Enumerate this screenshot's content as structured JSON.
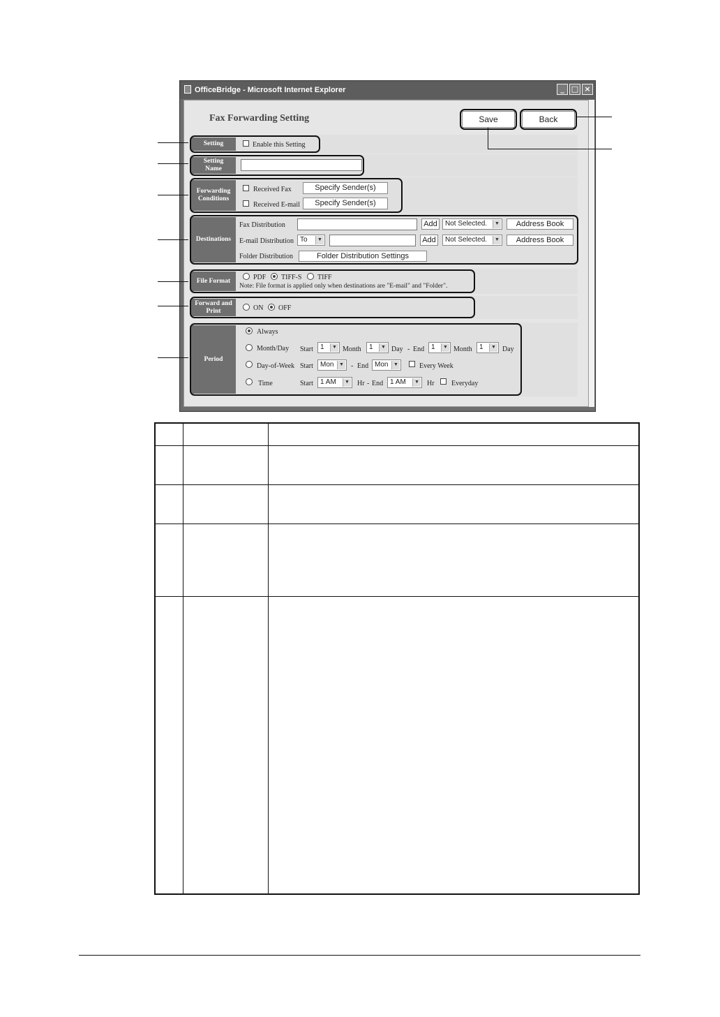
{
  "window": {
    "title": "OfficeBridge - Microsoft Internet Explorer",
    "minimize": "_",
    "maximize": "□",
    "close": "×"
  },
  "page": {
    "title": "Fax Forwarding Setting",
    "save_label": "Save",
    "back_label": "Back"
  },
  "setting": {
    "label": "Setting",
    "enable_label": "Enable this Setting"
  },
  "setting_name": {
    "label_line1": "Setting",
    "label_line2": "Name",
    "value": ""
  },
  "forwarding_conditions": {
    "label_line1": "Forwarding",
    "label_line2": "Conditions",
    "received_fax": "Received Fax",
    "received_email": "Received E-mail",
    "specify_sender": "Specify Sender(s)"
  },
  "destinations": {
    "label": "Destinations",
    "fax_distribution": "Fax Distribution",
    "email_distribution": "E-mail Distribution",
    "folder_distribution": "Folder Distribution",
    "to_option": "To",
    "add": "Add",
    "not_selected": "Not Selected.",
    "address_book": "Address Book",
    "folder_settings": "Folder Distribution Settings"
  },
  "file_format": {
    "label": "File Format",
    "pdf": "PDF",
    "tiff_s": "TIFF-S",
    "tiff": "TIFF",
    "selected": "TIFF-S",
    "note": "Note: File format is applied only when destinations are \"E-mail\" and \"Folder\"."
  },
  "forward_print": {
    "label_line1": "Forward and",
    "label_line2": "Print",
    "on": "ON",
    "off": "OFF",
    "selected": "OFF"
  },
  "period": {
    "label": "Period",
    "always": "Always",
    "month_day": "Month/Day",
    "day_of_week": "Day-of-Week",
    "time": "Time",
    "start": "Start",
    "end": "End",
    "month": "Month",
    "day": "Day",
    "hr": "Hr",
    "every_week": "Every Week",
    "everyday": "Everyday",
    "one": "1",
    "mon": "Mon",
    "one_am": "1 AM",
    "dash": "-",
    "selected": "Always"
  }
}
